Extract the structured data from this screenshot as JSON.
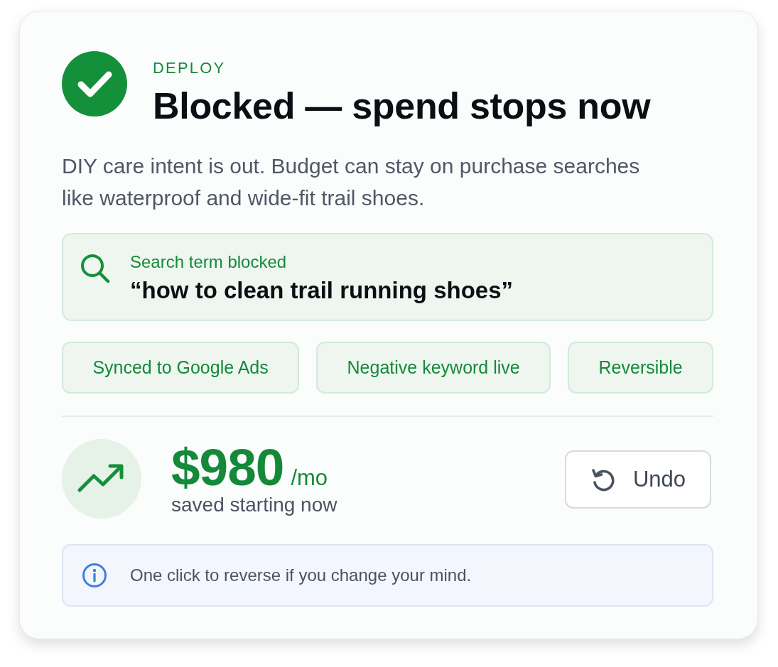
{
  "header": {
    "eyebrow": "DEPLOY",
    "title": "Blocked — spend stops now"
  },
  "description": "DIY care intent is out. Budget can stay on purchase searches like waterproof and wide-fit trail shoes.",
  "blocked_term": {
    "label": "Search term blocked",
    "term": "“how to clean trail running shoes”"
  },
  "chips": [
    "Synced to Google Ads",
    "Negative keyword live",
    "Reversible"
  ],
  "savings": {
    "amount": "$980",
    "unit": "/mo",
    "caption": "saved starting now"
  },
  "undo_button": {
    "label": "Undo"
  },
  "info": {
    "text": "One click to reverse if you change your mind."
  }
}
